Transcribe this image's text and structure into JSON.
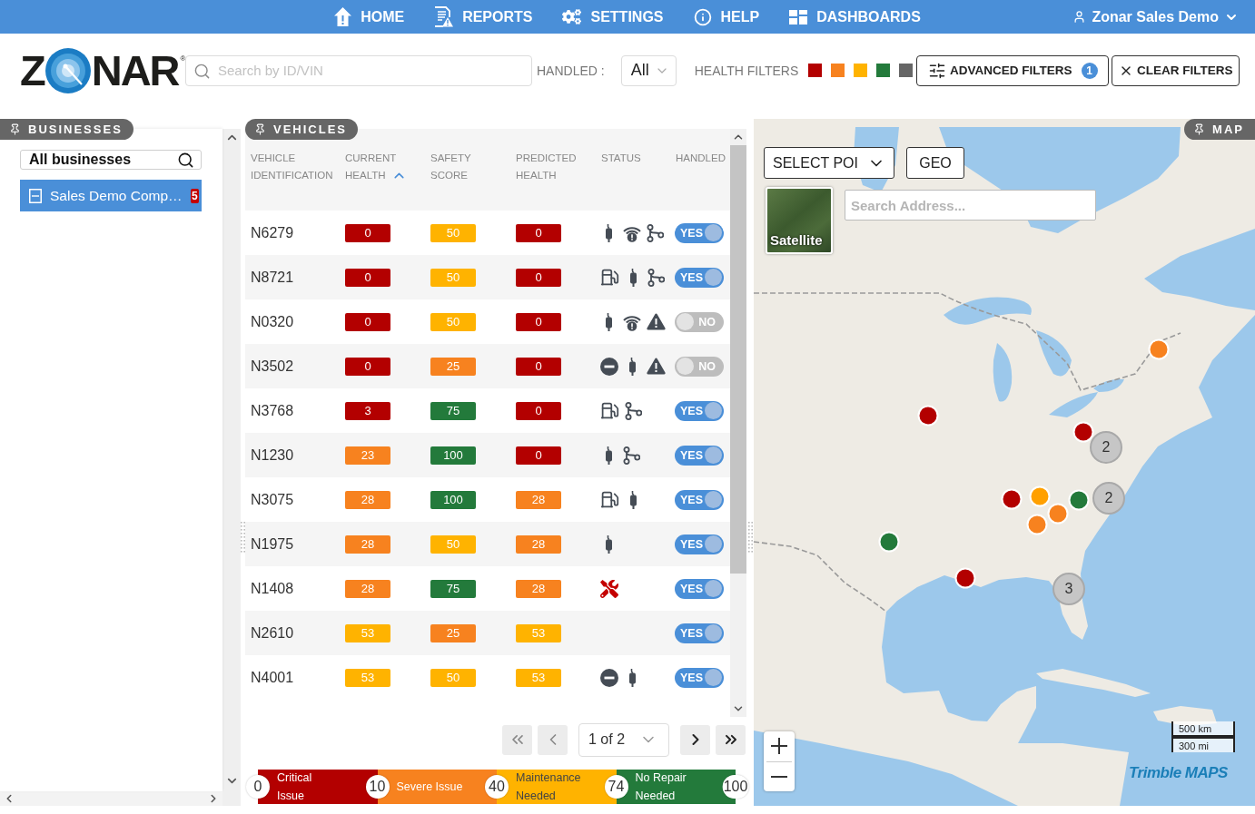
{
  "nav": {
    "items": [
      {
        "kind": "home",
        "label": "HOME"
      },
      {
        "kind": "reports",
        "label": "REPORTS"
      },
      {
        "kind": "settings",
        "label": "SETTINGS"
      },
      {
        "kind": "help",
        "label": "HELP"
      },
      {
        "kind": "dashboards",
        "label": "DASHBOARDS"
      }
    ],
    "user": "Zonar Sales Demo"
  },
  "header": {
    "logo": {
      "start": "Z",
      "end": "NAR",
      "mark": "®"
    },
    "search": {
      "placeholder": "Search by ID/VIN"
    },
    "handled": {
      "label": "HANDLED :",
      "value": "All"
    },
    "health_filters": {
      "label": "HEALTH FILTERS",
      "items": [
        {
          "color": "#b30000"
        },
        {
          "color": "#f7821f"
        },
        {
          "color": "#ffb300"
        },
        {
          "color": "#237a3b"
        },
        {
          "color": "#666666"
        }
      ]
    },
    "advanced_filters": {
      "label": "ADVANCED FILTERS",
      "badge": "1"
    },
    "clear_filters": {
      "label": "CLEAR FILTERS"
    }
  },
  "businesses": {
    "title": "BUSINESSES",
    "search": {
      "value": "All businesses"
    },
    "items": [
      {
        "label": "Sales Demo Comp…",
        "badge": "5",
        "selected": true
      }
    ]
  },
  "vehicles": {
    "title": "VEHICLES",
    "columns": [
      {
        "label": "VEHICLE IDENTIFICATION",
        "sorted": false
      },
      {
        "label": "CURRENT HEALTH",
        "sorted": true
      },
      {
        "label": "SAFETY SCORE",
        "sorted": false
      },
      {
        "label": "PREDICTED HEALTH",
        "sorted": false
      },
      {
        "label": "STATUS",
        "sorted": false
      },
      {
        "label": "HANDLED",
        "sorted": false
      }
    ],
    "rows": [
      {
        "id": "N6279",
        "current_health": {
          "value": "0",
          "color": "#b30000"
        },
        "safety_score": {
          "value": "50",
          "color": "#ffb300"
        },
        "predicted_health": {
          "value": "0",
          "color": "#b30000"
        },
        "status": [
          {
            "kind": "plug"
          },
          {
            "kind": "signal_alert"
          },
          {
            "kind": "route"
          }
        ],
        "handled": {
          "on": true,
          "label": "YES"
        }
      },
      {
        "id": "N8721",
        "current_health": {
          "value": "0",
          "color": "#b30000"
        },
        "safety_score": {
          "value": "50",
          "color": "#ffb300"
        },
        "predicted_health": {
          "value": "0",
          "color": "#b30000"
        },
        "status": [
          {
            "kind": "fuel"
          },
          {
            "kind": "plug"
          },
          {
            "kind": "route"
          }
        ],
        "handled": {
          "on": true,
          "label": "YES"
        }
      },
      {
        "id": "N0320",
        "current_health": {
          "value": "0",
          "color": "#b30000"
        },
        "safety_score": {
          "value": "50",
          "color": "#ffb300"
        },
        "predicted_health": {
          "value": "0",
          "color": "#b30000"
        },
        "status": [
          {
            "kind": "plug"
          },
          {
            "kind": "signal_alert"
          },
          {
            "kind": "warning"
          }
        ],
        "handled": {
          "on": false,
          "label": "NO"
        }
      },
      {
        "id": "N3502",
        "current_health": {
          "value": "0",
          "color": "#b30000"
        },
        "safety_score": {
          "value": "25",
          "color": "#f7821f"
        },
        "predicted_health": {
          "value": "0",
          "color": "#b30000"
        },
        "status": [
          {
            "kind": "blocked"
          },
          {
            "kind": "plug"
          },
          {
            "kind": "warning"
          }
        ],
        "handled": {
          "on": false,
          "label": "NO"
        }
      },
      {
        "id": "N3768",
        "current_health": {
          "value": "3",
          "color": "#b30000"
        },
        "safety_score": {
          "value": "75",
          "color": "#237a3b"
        },
        "predicted_health": {
          "value": "0",
          "color": "#b30000"
        },
        "status": [
          {
            "kind": "fuel"
          },
          {
            "kind": "route"
          }
        ],
        "handled": {
          "on": true,
          "label": "YES"
        }
      },
      {
        "id": "N1230",
        "current_health": {
          "value": "23",
          "color": "#f7821f"
        },
        "safety_score": {
          "value": "100",
          "color": "#237a3b"
        },
        "predicted_health": {
          "value": "0",
          "color": "#b30000"
        },
        "status": [
          {
            "kind": "plug"
          },
          {
            "kind": "route"
          }
        ],
        "handled": {
          "on": true,
          "label": "YES"
        }
      },
      {
        "id": "N3075",
        "current_health": {
          "value": "28",
          "color": "#f7821f"
        },
        "safety_score": {
          "value": "100",
          "color": "#237a3b"
        },
        "predicted_health": {
          "value": "28",
          "color": "#f7821f"
        },
        "status": [
          {
            "kind": "fuel"
          },
          {
            "kind": "plug"
          }
        ],
        "handled": {
          "on": true,
          "label": "YES"
        }
      },
      {
        "id": "N1975",
        "current_health": {
          "value": "28",
          "color": "#f7821f"
        },
        "safety_score": {
          "value": "50",
          "color": "#ffb300"
        },
        "predicted_health": {
          "value": "28",
          "color": "#f7821f"
        },
        "status": [
          {
            "kind": "plug"
          }
        ],
        "handled": {
          "on": true,
          "label": "YES"
        }
      },
      {
        "id": "N1408",
        "current_health": {
          "value": "28",
          "color": "#f7821f"
        },
        "safety_score": {
          "value": "75",
          "color": "#237a3b"
        },
        "predicted_health": {
          "value": "28",
          "color": "#f7821f"
        },
        "status": [
          {
            "kind": "tools"
          }
        ],
        "handled": {
          "on": true,
          "label": "YES"
        }
      },
      {
        "id": "N2610",
        "current_health": {
          "value": "53",
          "color": "#ffb300"
        },
        "safety_score": {
          "value": "25",
          "color": "#f7821f"
        },
        "predicted_health": {
          "value": "53",
          "color": "#ffb300"
        },
        "handled": {
          "on": true,
          "label": "YES"
        }
      },
      {
        "id": "N4001",
        "current_health": {
          "value": "53",
          "color": "#ffb300"
        },
        "safety_score": {
          "value": "50",
          "color": "#ffb300"
        },
        "predicted_health": {
          "value": "53",
          "color": "#ffb300"
        },
        "status": [
          {
            "kind": "blocked"
          },
          {
            "kind": "plug"
          }
        ],
        "handled": {
          "on": true,
          "label": "YES"
        }
      }
    ],
    "pagination": {
      "page": "1 of 2",
      "buttons": [
        {
          "kind": "first",
          "disabled": true
        },
        {
          "kind": "previous",
          "disabled": true
        },
        {
          "kind": "next",
          "disabled": false
        },
        {
          "kind": "last",
          "disabled": false
        }
      ]
    },
    "legend": {
      "segments": [
        {
          "label": "Critical\nIssue",
          "color": "#b30000"
        },
        {
          "label": "Severe Issue",
          "color": "#f7821f"
        },
        {
          "label": "Maintenance\nNeeded",
          "color": "#ffb300"
        },
        {
          "label": "No Repair\nNeeded",
          "color": "#237a3b"
        }
      ],
      "ticks": [
        "0",
        "10",
        "40",
        "74",
        "100"
      ]
    }
  },
  "map": {
    "title": "MAP",
    "poi_select": "SELECT POI",
    "geo": "GEO",
    "satellite": "Satellite",
    "search": {
      "placeholder": "Search Address..."
    },
    "markers": [
      {
        "kind": "dot",
        "color": "#f7821f"
      },
      {
        "kind": "dot",
        "color": "#b30000"
      },
      {
        "kind": "dot",
        "color": "#b30000"
      },
      {
        "kind": "cluster",
        "count": "2"
      },
      {
        "kind": "dot",
        "color": "#ffa000"
      },
      {
        "kind": "dot",
        "color": "#b30000"
      },
      {
        "kind": "dot",
        "color": "#237a3b"
      },
      {
        "kind": "cluster",
        "count": "2"
      },
      {
        "kind": "dot",
        "color": "#f7821f"
      },
      {
        "kind": "dot",
        "color": "#f7821f"
      },
      {
        "kind": "dot",
        "color": "#237a3b"
      },
      {
        "kind": "dot",
        "color": "#b30000"
      },
      {
        "kind": "cluster",
        "count": "3"
      }
    ],
    "scale": [
      "500 km",
      "300 mi"
    ],
    "attribution": "Trimble MAPS"
  }
}
